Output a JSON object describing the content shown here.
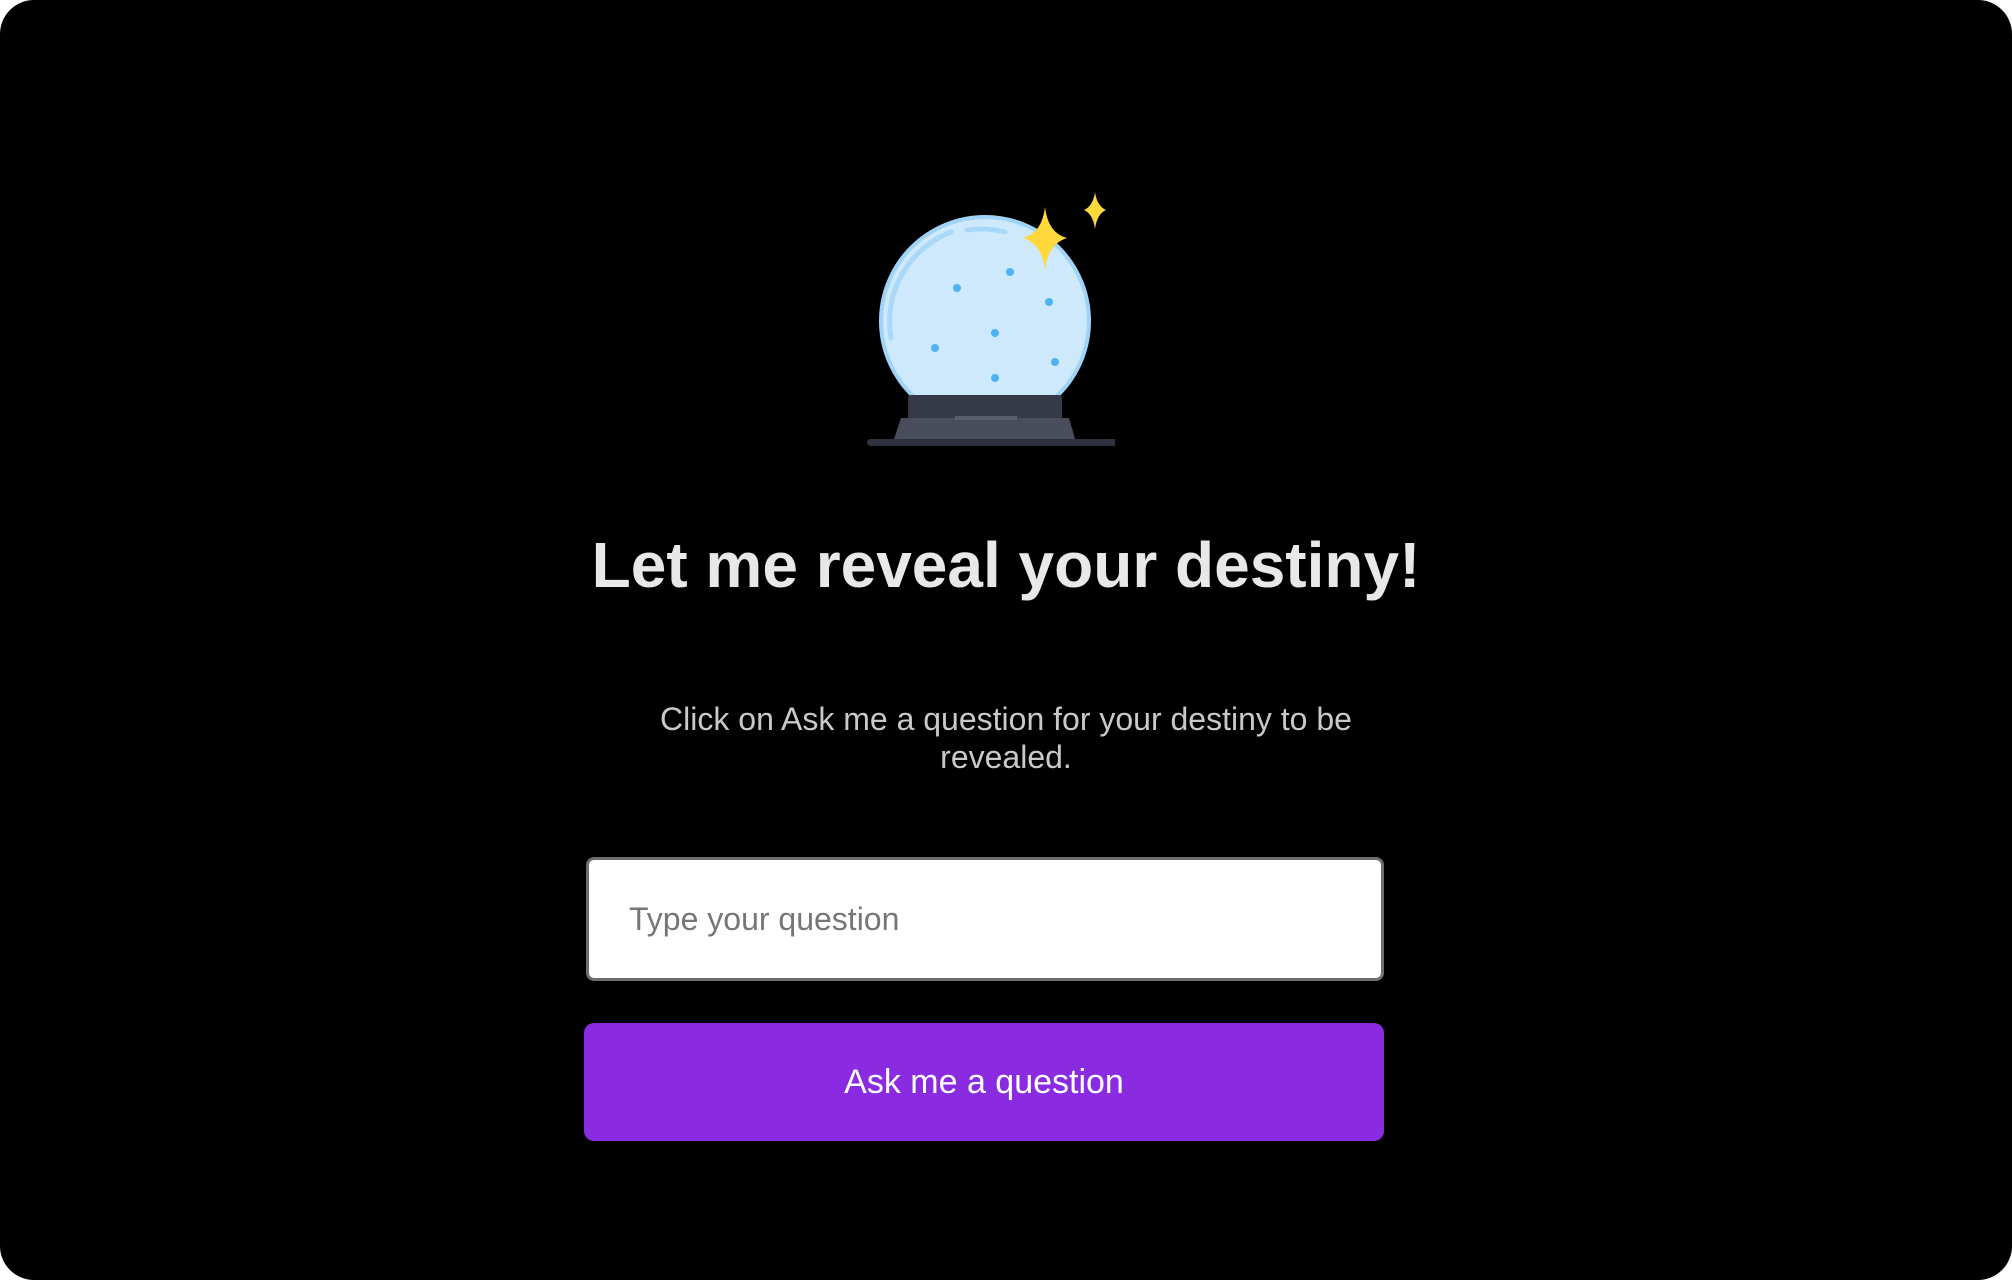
{
  "hero": {
    "icon": "crystal-ball-icon",
    "title": "Let me reveal your destiny!",
    "subtitle": "Click on Ask me a question for your destiny to be revealed."
  },
  "form": {
    "question_placeholder": "Type your question",
    "question_value": "",
    "submit_label": "Ask me a question"
  },
  "colors": {
    "background": "#000000",
    "title": "#e8e8e8",
    "subtitle": "#c9c9c9",
    "button": "#8a2be2",
    "button_text": "#ffffff",
    "globe": "#cde9fb",
    "sparkle": "#ffd83b",
    "stand": "#3c3f4d"
  }
}
